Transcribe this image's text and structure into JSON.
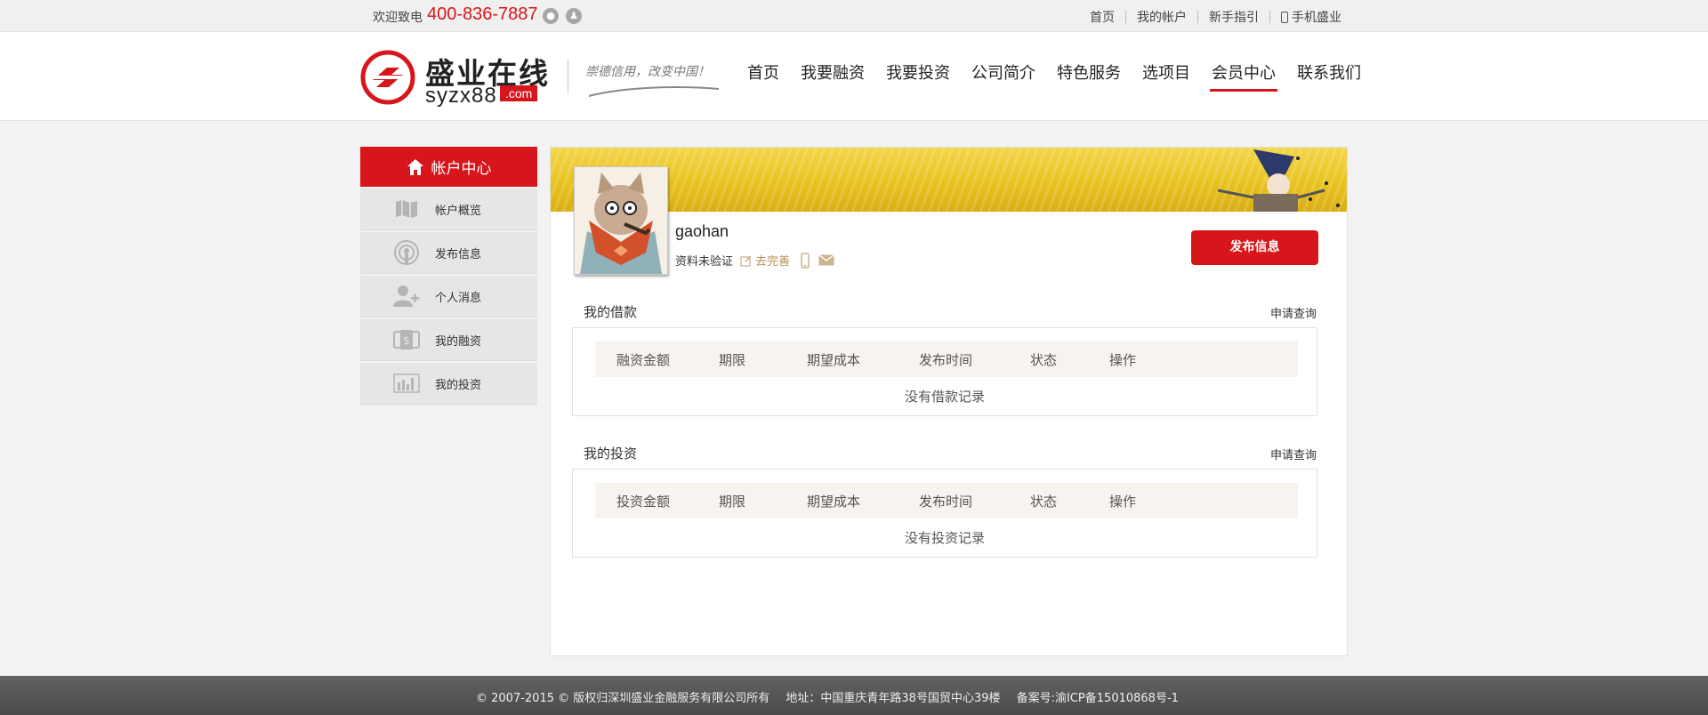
{
  "topbar": {
    "welcome": "欢迎致电",
    "phone": "400-836-7887",
    "links": [
      "首页",
      "我的帐户",
      "新手指引",
      "手机盛业"
    ]
  },
  "header": {
    "brand_cn": "盛业在线",
    "brand_en": "syzx88",
    "brand_domain": ".com",
    "slogan": "崇德信用，改变中国！",
    "nav": [
      "首页",
      "我要融资",
      "我要投资",
      "公司简介",
      "特色服务",
      "选项目",
      "会员中心",
      "联系我们"
    ],
    "active_nav": "会员中心"
  },
  "sidebar": {
    "title": "帐户中心",
    "items": [
      {
        "label": "帐户概览",
        "icon": "map-icon"
      },
      {
        "label": "发布信息",
        "icon": "podcast-icon"
      },
      {
        "label": "个人消息",
        "icon": "add-user-icon"
      },
      {
        "label": "我的融资",
        "icon": "money-icon"
      },
      {
        "label": "我的投资",
        "icon": "bar-chart-icon"
      }
    ]
  },
  "profile": {
    "username": "gaohan",
    "verify_status": "资料未验证",
    "complete_link": "去完善",
    "publish_button": "发布信息"
  },
  "loans": {
    "title": "我的借款",
    "link": "申请查询",
    "columns": [
      "融资金额",
      "期限",
      "期望成本",
      "发布时间",
      "状态",
      "操作"
    ],
    "empty": "没有借款记录"
  },
  "investments": {
    "title": "我的投资",
    "link": "申请查询",
    "columns": [
      "投资金额",
      "期限",
      "期望成本",
      "发布时间",
      "状态",
      "操作"
    ],
    "empty": "没有投资记录"
  },
  "footer": {
    "copyright": "© 2007-2015 © 版权归深圳盛业金融服务有限公司所有",
    "address": "地址：中国重庆青年路38号国贸中心39楼",
    "icp": "备案号:渝ICP备15010868号-1"
  },
  "colors": {
    "accent": "#d7161b",
    "banner": "#e8c320",
    "footer": "#555555"
  }
}
